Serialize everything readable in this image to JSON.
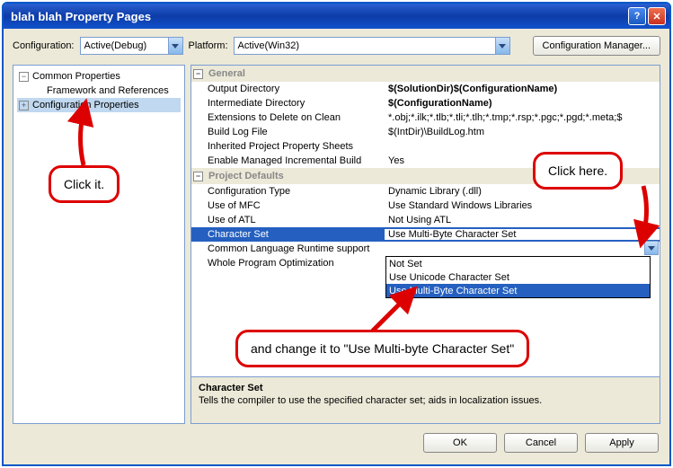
{
  "title": "blah blah Property Pages",
  "toolbar": {
    "config_label": "Configuration:",
    "config_value": "Active(Debug)",
    "platform_label": "Platform:",
    "platform_value": "Active(Win32)",
    "cfg_mgr": "Configuration Manager..."
  },
  "tree": {
    "common": "Common Properties",
    "framework": "Framework and References",
    "config": "Configuration Properties"
  },
  "groups": {
    "general": "General",
    "defaults": "Project Defaults"
  },
  "props": {
    "out_dir": {
      "n": "Output Directory",
      "v": "$(SolutionDir)$(ConfigurationName)"
    },
    "int_dir": {
      "n": "Intermediate Directory",
      "v": "$(ConfigurationName)"
    },
    "ext_del": {
      "n": "Extensions to Delete on Clean",
      "v": "*.obj;*.ilk;*.tlb;*.tli;*.tlh;*.tmp;*.rsp;*.pgc;*.pgd;*.meta;$"
    },
    "build_log": {
      "n": "Build Log File",
      "v": "$(IntDir)\\BuildLog.htm"
    },
    "inherit": {
      "n": "Inherited Project Property Sheets",
      "v": ""
    },
    "managed": {
      "n": "Enable Managed Incremental Build",
      "v": "Yes"
    },
    "cfg_type": {
      "n": "Configuration Type",
      "v": "Dynamic Library (.dll)"
    },
    "mfc": {
      "n": "Use of MFC",
      "v": "Use Standard Windows Libraries"
    },
    "atl": {
      "n": "Use of ATL",
      "v": "Not Using ATL"
    },
    "charset": {
      "n": "Character Set",
      "v": "Use Multi-Byte Character Set"
    },
    "clr": {
      "n": "Common Language Runtime support",
      "v": ""
    },
    "wpo": {
      "n": "Whole Program Optimization",
      "v": ""
    }
  },
  "dropdown": {
    "o1": "Not Set",
    "o2": "Use Unicode Character Set",
    "o3": "Use Multi-Byte Character Set"
  },
  "desc": {
    "title": "Character Set",
    "text": "Tells the compiler to use the specified character set; aids in localization issues."
  },
  "buttons": {
    "ok": "OK",
    "cancel": "Cancel",
    "apply": "Apply"
  },
  "callouts": {
    "c1": "Click it.",
    "c2": "Click here.",
    "c3": "and change it to \"Use Multi-byte Character Set\""
  }
}
